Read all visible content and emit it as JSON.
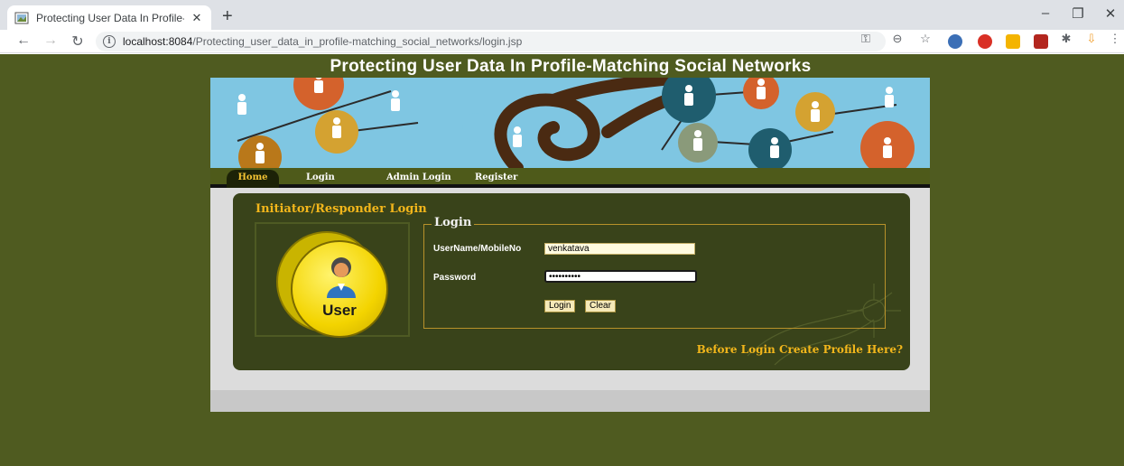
{
  "browser": {
    "tab_title": "Protecting User Data In Profile-M",
    "url_host": "localhost:8084",
    "url_path": "/Protecting_user_data_in_profile-matching_social_networks/login.jsp"
  },
  "site": {
    "title": "Protecting User Data In Profile-Matching Social Networks"
  },
  "nav": {
    "items": [
      {
        "label": "Home",
        "active": true
      },
      {
        "label": "Login"
      },
      {
        "label": "Admin Login"
      },
      {
        "label": "Register"
      }
    ]
  },
  "login_panel": {
    "heading": "Initiator/Responder Login",
    "badge_label": "User",
    "legend": "Login",
    "username_label": "UserName/MobileNo",
    "username_value": "venkatava",
    "password_label": "Password",
    "password_mask": "••••••••••",
    "login_button": "Login",
    "clear_button": "Clear",
    "create_profile_link": "Before Login Create Profile Here?"
  },
  "colors": {
    "page_bg": "#4f5b20",
    "panel_bg": "#39431a",
    "accent": "#f2b61b",
    "banner_sky": "#7fc6e2"
  }
}
